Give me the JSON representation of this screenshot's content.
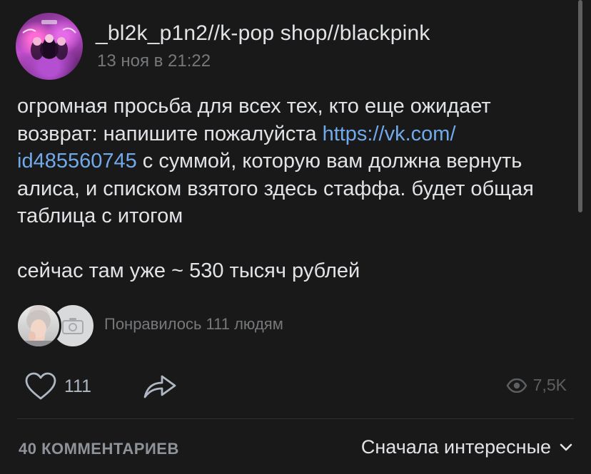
{
  "author": {
    "name": "_bl2k_p1n2//k-pop shop//blackpink",
    "date": "13 ноя в 21:22",
    "avatar_icon": "group-avatar"
  },
  "post": {
    "line1": "огромная просьба для всех тех, кто еще ожидает",
    "line2_text": "возврат: напишите пожалуйста ",
    "link_part1": "https://vk.com/",
    "link_part2": "id485560745",
    "line3_text": " с суммой, которую вам должна вернуть",
    "line4": "алиса, и списком взятого здесь стаффа. будет общая",
    "line5": "таблица с итогом",
    "line6": "сейчас там уже ~ 530 тысяч рублей"
  },
  "likes": {
    "text": "Понравилось 111 людям",
    "liker_icons": [
      "liker-avatar-photo",
      "camera-placeholder-icon"
    ]
  },
  "actions": {
    "like_count": "111",
    "view_count": "7,5K",
    "icons": {
      "like": "heart-outline-icon",
      "share": "share-arrow-icon",
      "views": "eye-icon"
    }
  },
  "comments": {
    "count_label": "40 КОММЕНТАРИЕВ",
    "sort_label": "Сначала интересные",
    "sort_icon": "chevron-down-icon"
  },
  "colors": {
    "background": "#19191a",
    "text": "#e1e3e6",
    "muted": "#76787a",
    "link": "#71aaeb"
  }
}
